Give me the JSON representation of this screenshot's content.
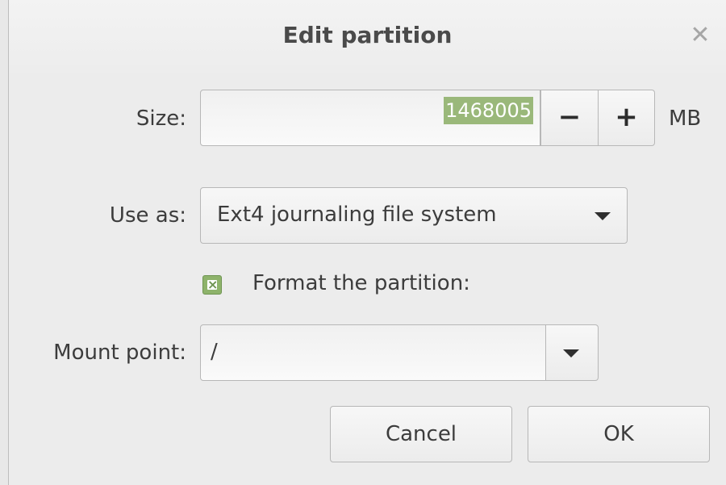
{
  "dialog": {
    "title": "Edit partition"
  },
  "size": {
    "label": "Size:",
    "value": "1468005",
    "decrement": "−",
    "increment": "+",
    "unit": "MB"
  },
  "use_as": {
    "label": "Use as:",
    "selected": "Ext4 journaling file system"
  },
  "format": {
    "label": "Format the partition:",
    "checked": true
  },
  "mount_point": {
    "label": "Mount point:",
    "value": "/"
  },
  "buttons": {
    "cancel": "Cancel",
    "ok": "OK"
  },
  "icons": {
    "close": "close-icon",
    "dropdown": "chevron-down-icon"
  },
  "colors": {
    "accent": "#8eb36b",
    "selection": "#9ab87a"
  }
}
